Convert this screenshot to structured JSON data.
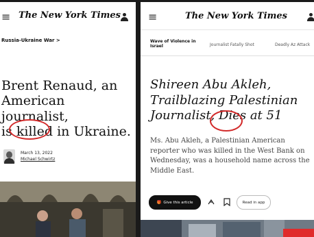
{
  "left": {
    "masthead": "The New York Times",
    "section": "Russia-Ukraine War >",
    "headline": {
      "line1": "Brent Renaud, an",
      "line2": "American journalist,",
      "line3_pre": "is ",
      "line3_circled": "killed",
      "line3_post": " in Ukraine."
    },
    "date": "March 13, 2022",
    "author": "Michael Schwirtz"
  },
  "right": {
    "masthead": "The New York Times",
    "tabs": [
      {
        "label": "Wave of Violence in Israel",
        "active": true
      },
      {
        "label": "Journalist Fatally Shot",
        "active": false
      },
      {
        "label": "Deadly Az Attack",
        "active": false
      }
    ],
    "headline": {
      "line1": "Shireen Abu Akleh,",
      "line2": "Trailblazing Palestinian",
      "line3_pre": "Journalist, ",
      "line3_circled": "Dies",
      "line3_post": " at 51"
    },
    "summary": "Ms. Abu Akleh, a Palestinian American reporter who was killed in the West Bank on Wednesday, was a household name across the Middle East.",
    "actions": {
      "gift": "Give this article",
      "read_in_app": "Read in app"
    }
  },
  "colors": {
    "annotation": "#d22a2a",
    "accent_bar": "#e02b2b"
  }
}
